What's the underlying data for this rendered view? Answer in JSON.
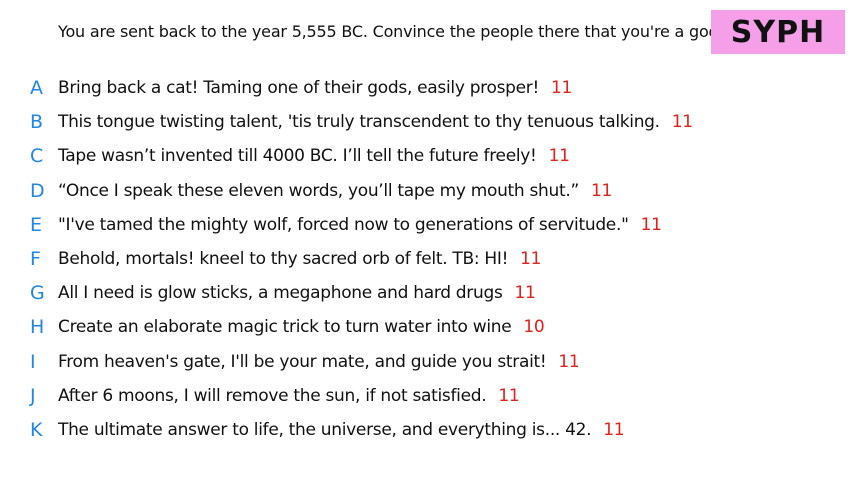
{
  "prompt": "You are sent back to the year 5,555 BC. Convince the people there that you're a god.",
  "badge": "SYPH",
  "answers": [
    {
      "letter": "A",
      "text": "Bring back a cat! Taming one of their gods, easily prosper!",
      "score": "11"
    },
    {
      "letter": "B",
      "text": "This tongue twisting talent, 'tis truly transcendent to thy tenuous talking.",
      "score": "11"
    },
    {
      "letter": "C",
      "text": "Tape wasn’t invented till 4000 BC. I’ll tell the future freely!",
      "score": "11"
    },
    {
      "letter": "D",
      "text": "“Once I speak these eleven words, you’ll tape my mouth shut.”",
      "score": "11"
    },
    {
      "letter": "E",
      "text": "\"I've tamed the mighty wolf, forced now to generations of servitude.\"",
      "score": "11"
    },
    {
      "letter": "F",
      "text": "Behold, mortals! kneel to thy sacred orb of felt. TB: HI!",
      "score": "11"
    },
    {
      "letter": "G",
      "text": "All I need is glow sticks, a megaphone and hard drugs",
      "score": "11"
    },
    {
      "letter": "H",
      "text": "Create an elaborate magic trick to turn water into wine",
      "score": "10"
    },
    {
      "letter": "I",
      "text": "From heaven's gate, I'll be your mate, and guide you strait!",
      "score": "11"
    },
    {
      "letter": "J",
      "text": "After 6 moons, I will remove the sun, if not satisfied.",
      "score": "11"
    },
    {
      "letter": "K",
      "text": "The ultimate answer to life, the universe, and everything is... 42.",
      "score": "11"
    }
  ],
  "colors": {
    "letter": "#1e87ea",
    "score": "#e32119",
    "badge_bg": "#f59fe8"
  }
}
